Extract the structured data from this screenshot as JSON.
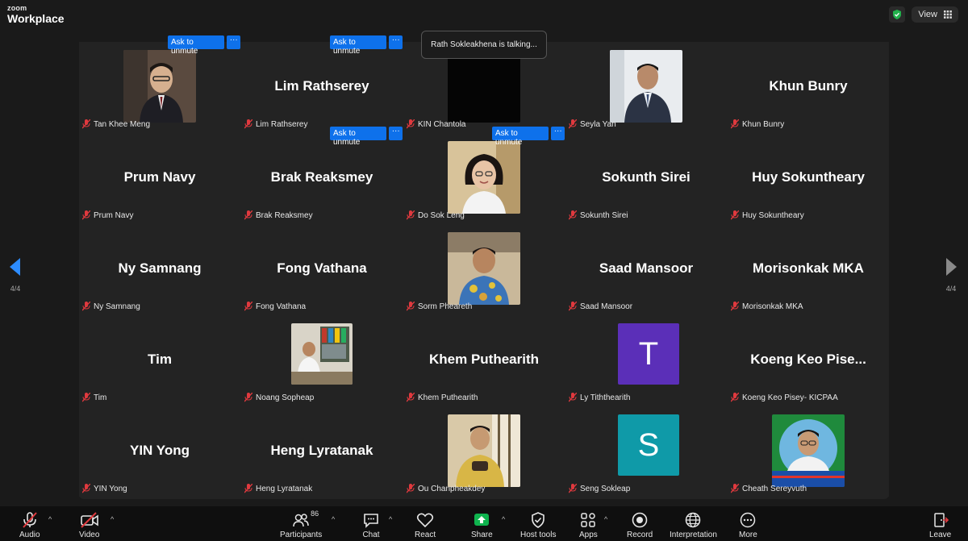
{
  "app": {
    "brand_line1": "zoom",
    "brand_line2": "Workplace",
    "view_label": "View"
  },
  "talking_indicator": "Rath Sokleakhena is talking...",
  "pagination": {
    "left": "4/4",
    "right": "4/4"
  },
  "ask_to_unmute": "Ask to unmute",
  "more_dots": "···",
  "tiles": [
    {
      "big": "",
      "label": "Tan Khee Meng"
    },
    {
      "big": "Lim Rathserey",
      "label": "Lim Rathserey"
    },
    {
      "big": "",
      "label": "KIN Chantola"
    },
    {
      "big": "",
      "label": "Seyla Yan"
    },
    {
      "big": "Khun Bunry",
      "label": "Khun Bunry"
    },
    {
      "big": "Prum Navy",
      "label": "Prum Navy"
    },
    {
      "big": "Brak Reaksmey",
      "label": "Brak Reaksmey"
    },
    {
      "big": "",
      "label": "Do Sok Leng"
    },
    {
      "big": "Sokunth Sirei",
      "label": "Sokunth Sirei"
    },
    {
      "big": "Huy Sokuntheary",
      "label": "Huy Sokuntheary"
    },
    {
      "big": "Ny Samnang",
      "label": "Ny Samnang"
    },
    {
      "big": "Fong Vathana",
      "label": "Fong Vathana"
    },
    {
      "big": "",
      "label": "Sorm Pheareth"
    },
    {
      "big": "Saad Mansoor",
      "label": "Saad Mansoor"
    },
    {
      "big": "Morisonkak MKA",
      "label": "Morisonkak MKA"
    },
    {
      "big": "Tim",
      "label": "Tim"
    },
    {
      "big": "",
      "label": "Noang Sopheap"
    },
    {
      "big": "Khem Puthearith",
      "label": "Khem Puthearith"
    },
    {
      "big": "",
      "label": "Ly Tiththearith",
      "avatar_letter": "T",
      "avatar_color": "#5b2fb8"
    },
    {
      "big": "Koeng Keo Pise...",
      "label": "Koeng Keo Pisey- KICPAA"
    },
    {
      "big": "YIN Yong",
      "label": "YIN Yong"
    },
    {
      "big": "Heng Lyratanak",
      "label": "Heng Lyratanak"
    },
    {
      "big": "",
      "label": "Ou Chanpheakdey"
    },
    {
      "big": "",
      "label": "Seng Sokleap",
      "avatar_letter": "S",
      "avatar_color": "#0f9aa8"
    },
    {
      "big": "",
      "label": "Cheath Sereyvuth"
    }
  ],
  "toolbar": {
    "audio": "Audio",
    "video": "Video",
    "participants": "Participants",
    "participants_count": "86",
    "chat": "Chat",
    "react": "React",
    "share": "Share",
    "host_tools": "Host tools",
    "apps": "Apps",
    "record": "Record",
    "interpretation": "Interpretation",
    "more": "More",
    "leave": "Leave"
  },
  "colors": {
    "accent_blue": "#0e71eb",
    "share_green": "#0fb34e",
    "muted_red": "#e0393e"
  }
}
